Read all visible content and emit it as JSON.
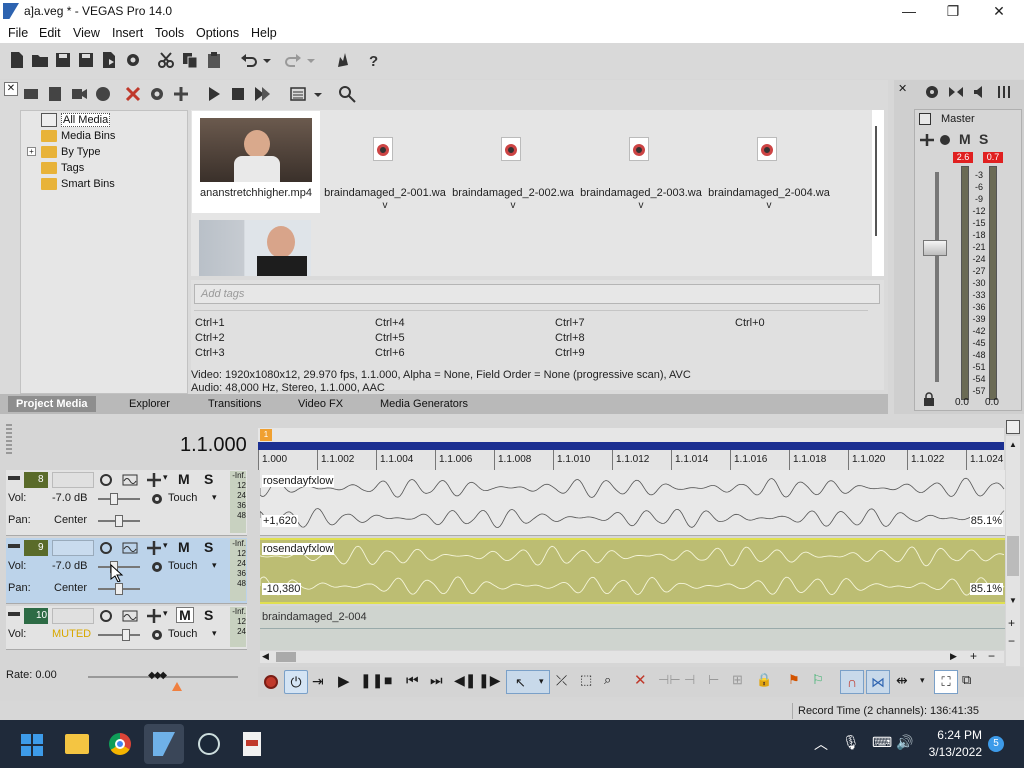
{
  "window": {
    "title": "a]a.veg * - VEGAS Pro 14.0",
    "controls": [
      "minimize-icon",
      "maximize-icon",
      "close-icon"
    ]
  },
  "menu": [
    "File",
    "Edit",
    "View",
    "Insert",
    "Tools",
    "Options",
    "Help"
  ],
  "media_tree": [
    "All Media",
    "Media Bins",
    "By Type",
    "Tags",
    "Smart Bins"
  ],
  "media_items": [
    {
      "label": "ananstretchhigher.mp4"
    },
    {
      "label": "braindamaged_2-001.wa",
      "sub": "v"
    },
    {
      "label": "braindamaged_2-002.wa",
      "sub": "v"
    },
    {
      "label": "braindamaged_2-003.wa",
      "sub": "v"
    },
    {
      "label": "braindamaged_2-004.wa",
      "sub": "v"
    }
  ],
  "tags_placeholder": "Add tags",
  "shortcuts": [
    [
      "Ctrl+1",
      "Ctrl+4",
      "Ctrl+7",
      "Ctrl+0"
    ],
    [
      "Ctrl+2",
      "Ctrl+5",
      "Ctrl+8",
      ""
    ],
    [
      "Ctrl+3",
      "Ctrl+6",
      "Ctrl+9",
      ""
    ]
  ],
  "media_info": {
    "video": "Video: 1920x1080x12, 29.970 fps, 1.1.000, Alpha = None, Field Order = None (progressive scan), AVC",
    "audio": "Audio: 48,000 Hz, Stereo, 1.1.000, AAC"
  },
  "tabs": [
    "Project Media",
    "Explorer",
    "Transitions",
    "Video FX",
    "Media Generators"
  ],
  "master": {
    "label": "Master",
    "M": "M",
    "S": "S",
    "peak_l": "2.6",
    "peak_r": "0.7",
    "scale": [
      "-3",
      "-6",
      "-9",
      "-12",
      "-15",
      "-18",
      "-21",
      "-24",
      "-27",
      "-30",
      "-33",
      "-36",
      "-39",
      "-42",
      "-45",
      "-48",
      "-51",
      "-54",
      "-57"
    ],
    "bottom_l": "0.0",
    "bottom_r": "0.0"
  },
  "timecode": "1.1.000",
  "ruler": [
    "1.000",
    "1.1.002",
    "1.1.004",
    "1.1.006",
    "1.1.008",
    "1.1.010",
    "1.1.012",
    "1.1.014",
    "1.1.016",
    "1.1.018",
    "1.1.020",
    "1.1.022",
    "1.1.024"
  ],
  "tracks": [
    {
      "num": "8",
      "vol_label": "Vol:",
      "vol": "-7.0 dB",
      "pan_label": "Pan:",
      "pan": "Center",
      "mode": "Touch",
      "M": "M",
      "S": "S",
      "meter": [
        "-Inf.",
        "12",
        "24",
        "36",
        "48"
      ],
      "clip": "rosendayfxlow",
      "offset": "+1,620",
      "zoom": "85.1%"
    },
    {
      "num": "9",
      "vol_label": "Vol:",
      "vol": "-7.0 dB",
      "pan_label": "Pan:",
      "pan": "Center",
      "mode": "Touch",
      "M": "M",
      "S": "S",
      "meter": [
        "-Inf.",
        "12",
        "24",
        "36",
        "48"
      ],
      "clip": "rosendayfxlow",
      "offset": "-10,380",
      "zoom": "85.1%"
    },
    {
      "num": "10",
      "vol_label": "Vol:",
      "vol": "MUTED",
      "mode": "Touch",
      "M": "M",
      "S": "S",
      "meter": [
        "-Inf.",
        "12",
        "24"
      ],
      "clip": "braindamaged_2-004"
    }
  ],
  "rate": "Rate: 0.00",
  "status": "Record Time (2 channels): 136:41:35",
  "clock": {
    "time": "6:24 PM",
    "date": "3/13/2022"
  },
  "notif_count": "5",
  "colors": {
    "accent": "#2d63b0",
    "track_sel": "#bcd3ea",
    "clip_yellow": "#bcbd73",
    "clip_gray": "#e3e3e3",
    "mute_orange": "#d8a800"
  }
}
